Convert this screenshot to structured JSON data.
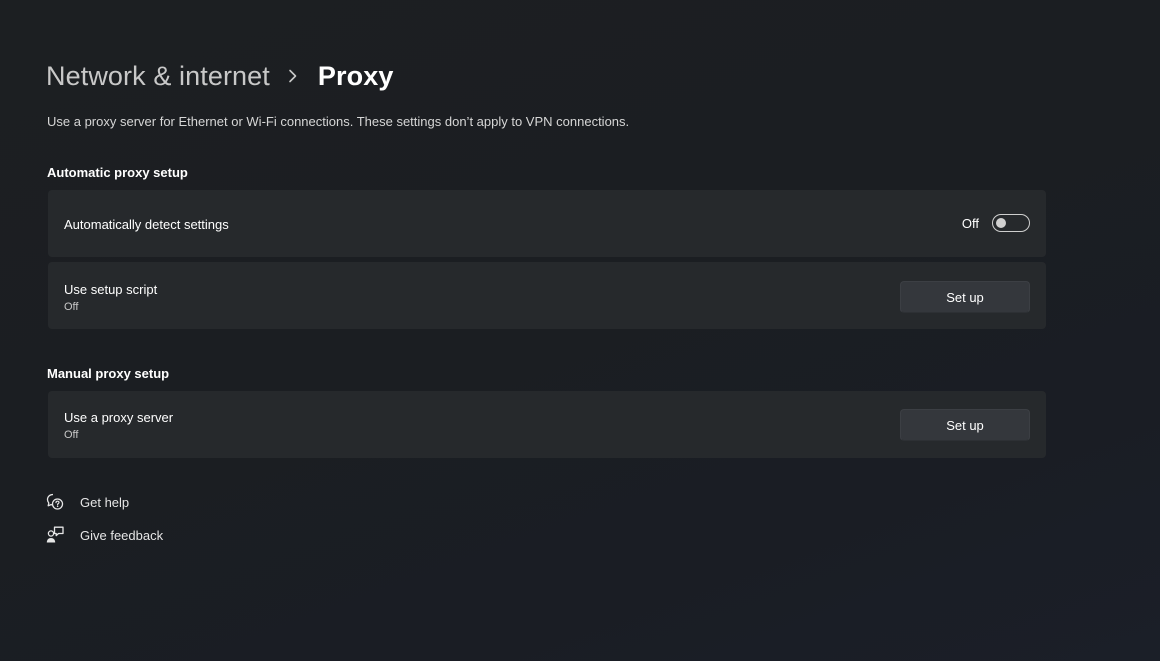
{
  "breadcrumb": {
    "parent": "Network & internet",
    "current": "Proxy"
  },
  "description": "Use a proxy server for Ethernet or Wi-Fi connections. These settings don’t apply to VPN connections.",
  "automatic": {
    "heading": "Automatic proxy setup",
    "detect": {
      "label": "Automatically detect settings",
      "state": "Off",
      "on": false
    },
    "script": {
      "label": "Use setup script",
      "status": "Off",
      "button": "Set up"
    }
  },
  "manual": {
    "heading": "Manual proxy setup",
    "proxy_server": {
      "label": "Use a proxy server",
      "status": "Off",
      "button": "Set up"
    }
  },
  "links": {
    "help": {
      "label": "Get help",
      "icon": "help-chat-icon"
    },
    "feedback": {
      "label": "Give feedback",
      "icon": "feedback-icon"
    }
  },
  "colors": {
    "background": "#1c1f22",
    "card": "#26292c",
    "button": "#34373c"
  }
}
